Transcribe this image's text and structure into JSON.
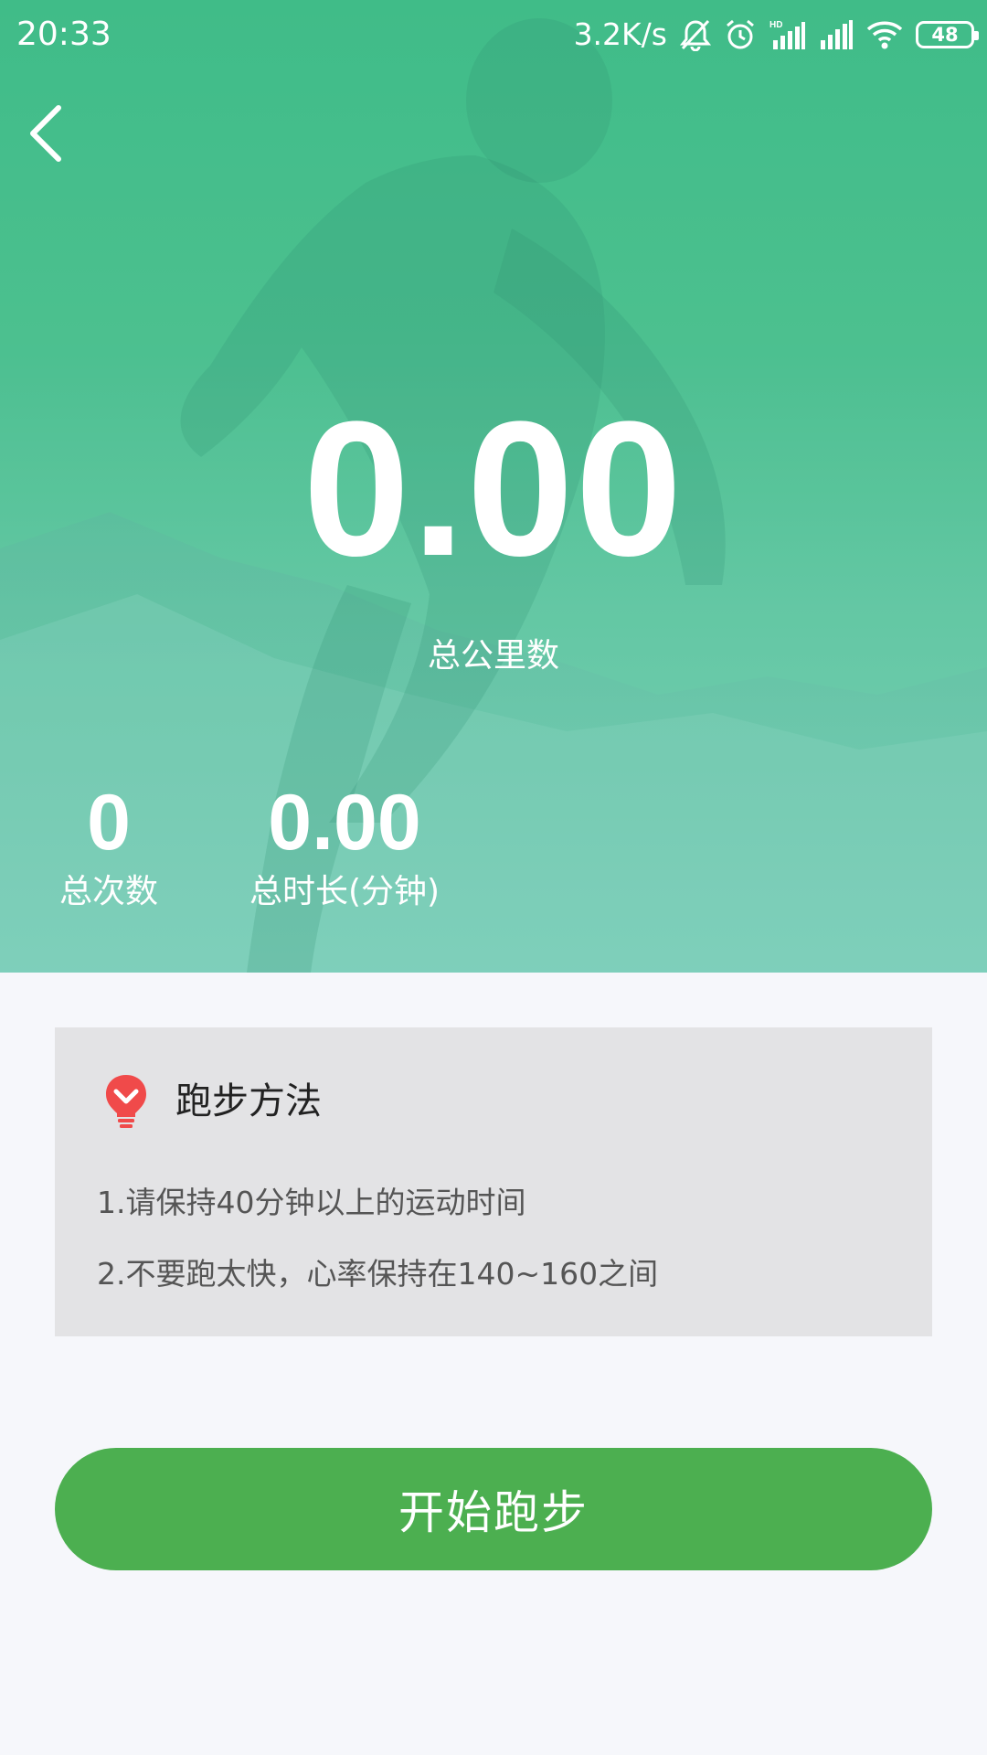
{
  "status_bar": {
    "time": "20:33",
    "network_speed": "3.2K/s",
    "battery_level": "48",
    "icons": [
      "notifications-muted-icon",
      "alarm-clock-icon",
      "hd-signal-icon",
      "cell-signal-icon",
      "wifi-icon",
      "battery-icon"
    ]
  },
  "header": {
    "back_icon": "chevron-left-icon"
  },
  "hero": {
    "total_km_value": "0.00",
    "total_km_label": "总公里数",
    "stats": [
      {
        "value": "0",
        "label": "总次数"
      },
      {
        "value": "0.00",
        "label": "总时长(分钟)"
      }
    ]
  },
  "tips": {
    "icon": "lightbulb-icon",
    "title": "跑步方法",
    "lines": [
      "1.请保持40分钟以上的运动时间",
      "2.不要跑太快，心率保持在140~160之间"
    ]
  },
  "actions": {
    "start_label": "开始跑步"
  },
  "colors": {
    "hero_green": "#3fbc88",
    "hero_teal": "#7fd0bd",
    "button_green": "#4caf50",
    "card_gray": "#e3e3e5",
    "bulb_red": "#f04a4a",
    "page_background": "#f6f7fb"
  }
}
